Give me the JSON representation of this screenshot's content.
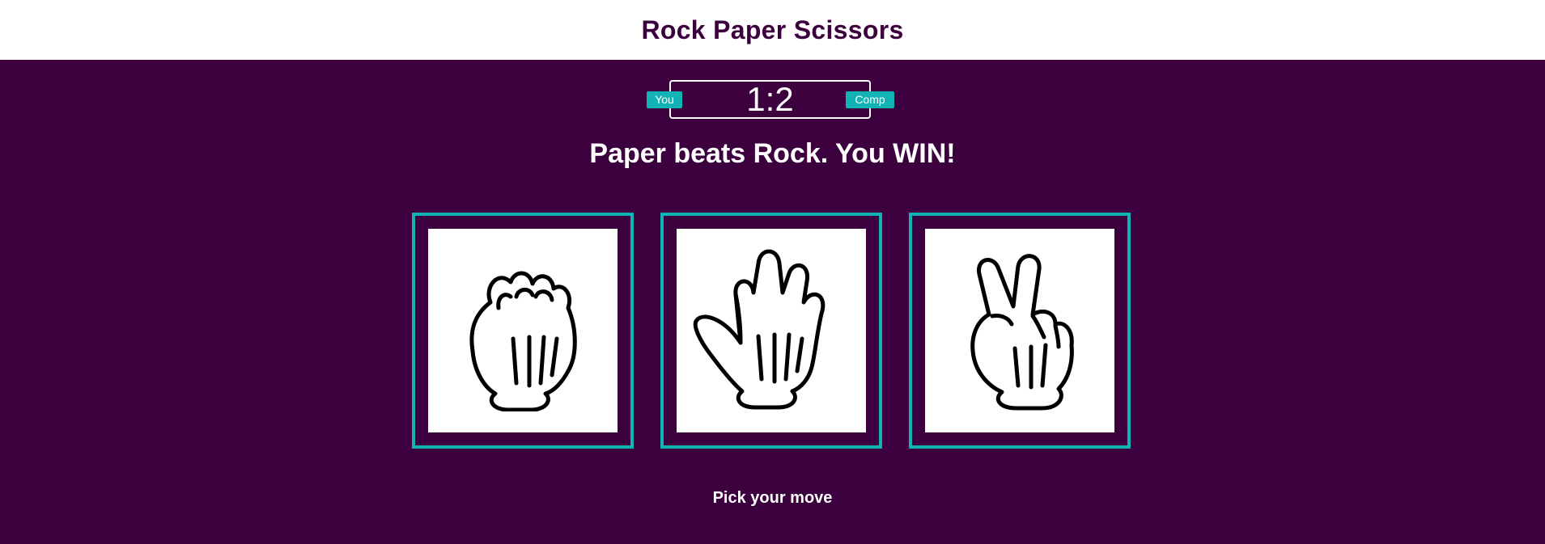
{
  "header": {
    "title": "Rock Paper Scissors"
  },
  "scoreboard": {
    "player_label": "You",
    "computer_label": "Comp",
    "player_score": 1,
    "computer_score": 2,
    "score_text": "1:2"
  },
  "result_message": "Paper beats Rock. You WIN!",
  "choices": [
    {
      "id": "rock",
      "icon": "rock-hand-icon"
    },
    {
      "id": "paper",
      "icon": "paper-hand-icon"
    },
    {
      "id": "scissors",
      "icon": "scissors-hand-icon"
    }
  ],
  "prompt": "Pick your move",
  "colors": {
    "background": "#3d003e",
    "header_background": "#ffffff",
    "accent": "#12b3b5",
    "text": "#ffffff"
  }
}
